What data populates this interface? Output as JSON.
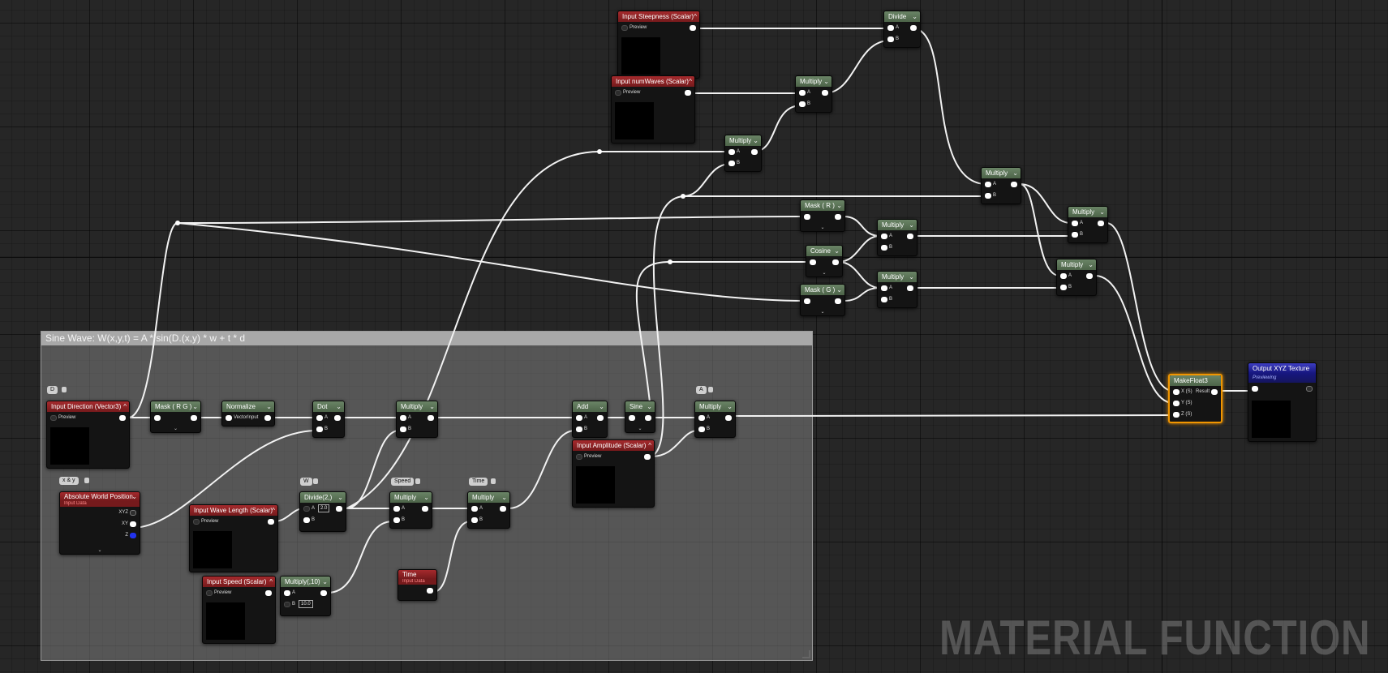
{
  "watermark": "MATERIAL FUNCTION",
  "comment": {
    "title": "Sine Wave: W(x,y,t) = A * sin(D.(x,y) * w + t * d"
  },
  "bubbles": {
    "d": "D",
    "xy": "x & y",
    "w": "W",
    "speed": "Speed",
    "time": "Time",
    "a": "A"
  },
  "labels": {
    "preview": "Preview",
    "a": "A",
    "b": "B",
    "vector_input": "VectorInput",
    "xyz": "XYZ",
    "xy": "XY",
    "z": "Z",
    "x_s": "X (S)",
    "y_s": "Y (S)",
    "z_s": "Z (S)",
    "result": "Result",
    "expand": "⌄"
  },
  "nodes": {
    "input_steepness": "Input Steepness (Scalar)",
    "input_num_waves": "Input numWaves (Scalar)",
    "divide_top": "Divide",
    "multiply_top1": "Multiply",
    "multiply_top2": "Multiply",
    "multiply_mid": "Multiply",
    "mask_r": "Mask ( R )",
    "cosine": "Cosine",
    "mask_g": "Mask ( G )",
    "multiply_r1": "Multiply",
    "multiply_r2": "Multiply",
    "multiply_x": "Multiply",
    "multiply_y": "Multiply",
    "make_float3": "MakeFloat3",
    "output_xyz": "Output XYZ Texture",
    "output_sub": "Previewing",
    "input_direction": "Input Direction (Vector3)",
    "mask_rg": "Mask ( R G )",
    "normalize": "Normalize",
    "dot": "Dot",
    "multiply_w": "Multiply",
    "add": "Add",
    "sine": "Sine",
    "multiply_a": "Multiply",
    "input_amplitude": "Input Amplitude (Scalar)",
    "abs_world_pos": "Absolute World Position",
    "abs_sub": "Input Data",
    "input_wave_length": "Input Wave Length (Scalar)",
    "divide_2": "Divide(2,)",
    "divide_2_const": "2.0",
    "multiply_speed": "Multiply",
    "multiply_time": "Multiply",
    "input_speed": "Input Speed (Scalar)",
    "multiply_10": "Multiply(,10)",
    "multiply_10_const": "10.0",
    "time": "Time",
    "time_sub": "Input Data"
  }
}
